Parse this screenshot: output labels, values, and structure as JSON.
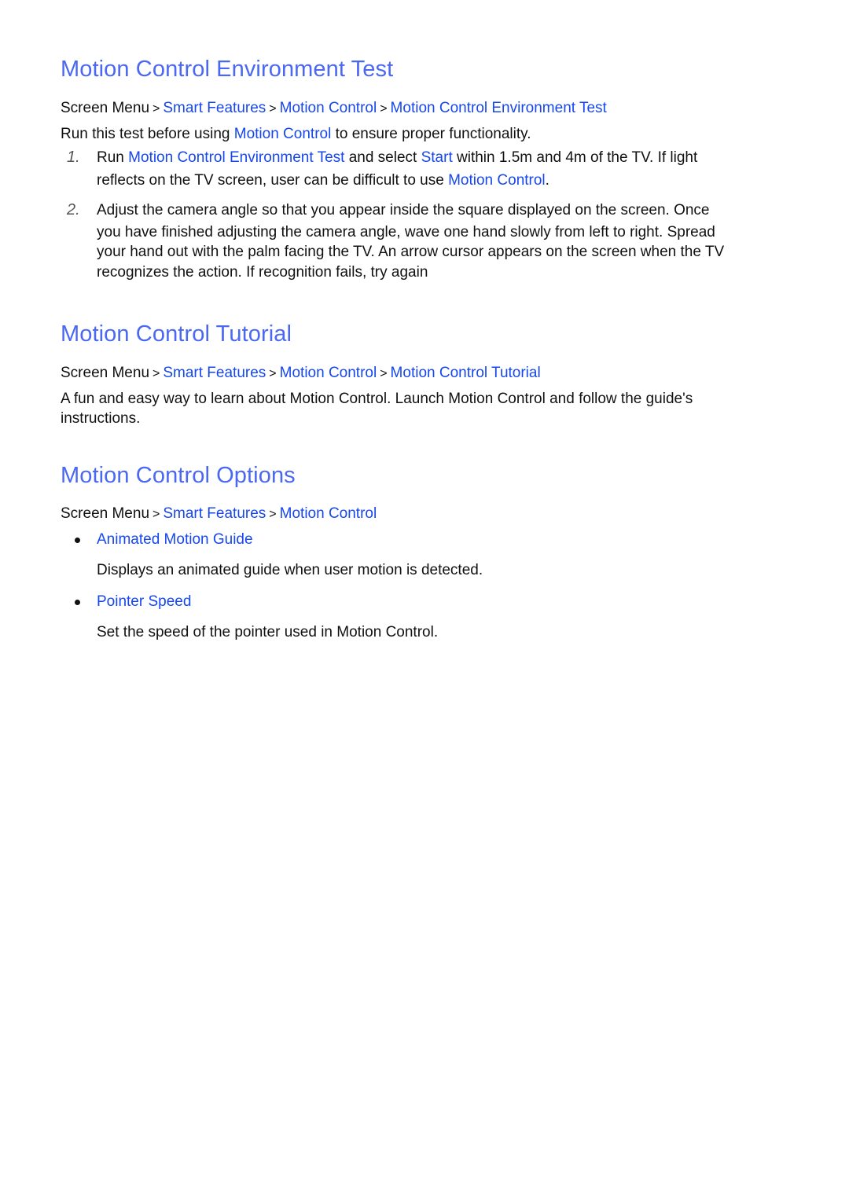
{
  "colors": {
    "heading": "#4a68f2",
    "link": "#1747ee",
    "text": "#111111"
  },
  "breadcrumb_separator": ">",
  "sections": [
    {
      "title": "Motion Control Environment Test",
      "breadcrumb": [
        "Screen Menu",
        "Smart Features",
        "Motion Control",
        "Motion Control Environment Test"
      ],
      "intro": {
        "before": "Run this test before using ",
        "link": "Motion Control",
        "after": " to ensure proper functionality."
      },
      "steps": [
        {
          "number": "1.",
          "line1": {
            "t1": "Run ",
            "link1": "Motion Control Environment Test",
            "t2": " and select ",
            "link2": "Start",
            "t3": " within 1.5m and 4m of the TV. If light"
          },
          "line2": {
            "t1": "reflects on the TV screen, user can be difficult to use ",
            "link1": "Motion Control",
            "t2": "."
          }
        },
        {
          "number": "2.",
          "lines": [
            "Adjust the camera angle so that you appear inside the square displayed on the screen. Once",
            "you have finished adjusting the camera angle, wave one hand slowly from left to right. Spread",
            "your hand out with the palm facing the TV. An arrow cursor appears on the screen when the TV",
            "recognizes the action. If recognition fails, try again"
          ]
        }
      ]
    },
    {
      "title": "Motion Control Tutorial",
      "breadcrumb": [
        "Screen Menu",
        "Smart Features",
        "Motion Control",
        "Motion Control Tutorial"
      ],
      "body_lines": [
        "A fun and easy way to learn about Motion Control. Launch Motion Control and follow the guide's",
        "instructions."
      ]
    },
    {
      "title": "Motion Control Options",
      "breadcrumb": [
        "Screen Menu",
        "Smart Features",
        "Motion Control"
      ],
      "options": [
        {
          "label": "Animated Motion Guide",
          "description": "Displays an animated guide when user motion is detected."
        },
        {
          "label": "Pointer Speed",
          "description": "Set the speed of the pointer used in Motion Control."
        }
      ]
    }
  ]
}
